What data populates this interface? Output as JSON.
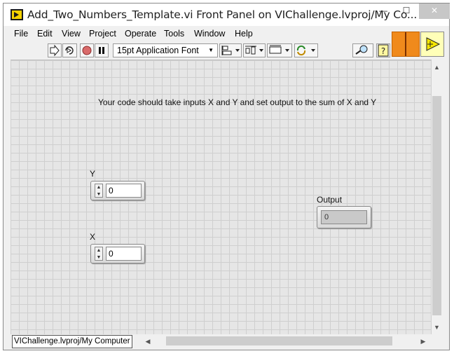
{
  "window": {
    "title": "Add_Two_Numbers_Template.vi Front Panel on VIChallenge.lvproj/My Co...",
    "controls": {
      "minimize": "—",
      "maximize": "☐",
      "close": "✕"
    }
  },
  "menu": {
    "items": [
      "File",
      "Edit",
      "View",
      "Project",
      "Operate",
      "Tools",
      "Window",
      "Help"
    ]
  },
  "toolbar": {
    "font": "15pt Application Font",
    "icons": [
      "run-arrow",
      "run-continuously",
      "abort",
      "pause",
      "align-objects",
      "distribute-objects",
      "resize-objects",
      "reorder",
      "search",
      "context-help"
    ]
  },
  "panel": {
    "instruction": "Your code should take inputs X and Y and set output to the sum of X and Y",
    "controls": {
      "y": {
        "label": "Y",
        "value": "0"
      },
      "x": {
        "label": "X",
        "value": "0"
      }
    },
    "indicators": {
      "output": {
        "label": "Output",
        "value": "0"
      }
    }
  },
  "status": {
    "context": "VIChallenge.lvproj/My Computer"
  },
  "colors": {
    "panel_background": "#e6e6e6",
    "grid": "#cfcfcf",
    "vi_icon": "#f08a1c",
    "connector": "#ffffb8"
  }
}
